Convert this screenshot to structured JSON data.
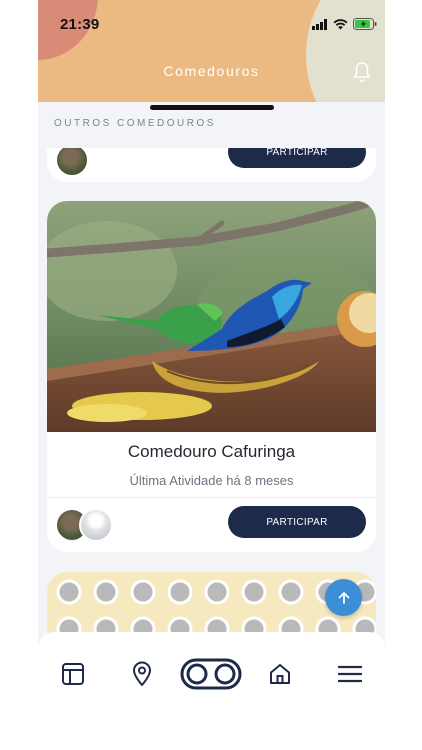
{
  "status_bar": {
    "time": "21:39"
  },
  "header": {
    "title": "Comedouros",
    "notification_icon": "bell-icon"
  },
  "section": {
    "label": "OUTROS COMEDOUROS"
  },
  "feeders": [
    {
      "button_label": "PARTICIPAR"
    },
    {
      "title": "Comedouro Cafuringa",
      "last_activity": "Última Atividade há 8 meses",
      "button_label": "PARTICIPAR"
    }
  ],
  "fab": {
    "icon": "arrow-up-icon"
  },
  "bottom_nav": {
    "items": [
      {
        "icon": "feed-icon"
      },
      {
        "icon": "map-pin-icon"
      },
      {
        "icon": "binoculars-icon"
      },
      {
        "icon": "home-icon"
      },
      {
        "icon": "menu-icon"
      }
    ]
  },
  "colors": {
    "header": "#ebba82",
    "primary_button": "#1d2a4a",
    "fab": "#3d8ed8",
    "nav_icon": "#1d2a4a"
  }
}
